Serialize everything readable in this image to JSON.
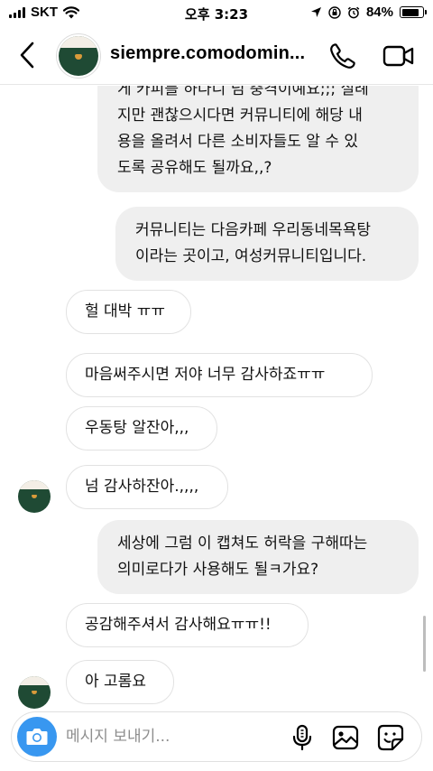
{
  "status_bar": {
    "carrier": "SKT",
    "time": "오후 3:23",
    "battery": "84%",
    "battery_level": 0.84
  },
  "header": {
    "username": "siempre.comodomin...",
    "icons": [
      "back-chevron-icon",
      "phone-icon",
      "video-camera-icon"
    ]
  },
  "messages": [
    {
      "side": "out",
      "text": "게 카피를 하다니 넘 충격이예요;;; 실례\n지만 괜찮으시다면 커뮤니티에 해당 내\n용을 올려서 다른 소비자들도 알 수 있\n도록 공유해도 될까요,,?"
    },
    {
      "side": "out",
      "text": "커뮤니티는 다음카페 우리동네목욕탕\n이라는 곳이고, 여성커뮤니티입니다."
    },
    {
      "side": "in",
      "text": "헐 대박 ㅠㅠ"
    },
    {
      "side": "in",
      "text": "마음써주시면 저야 너무 감사하죠ㅠㅠ"
    },
    {
      "side": "in",
      "text": "우동탕 알잔아,,,"
    },
    {
      "side": "in",
      "text": "넘 감사하잔아.,,,,"
    },
    {
      "side": "out",
      "text": "세상에 그럼 이 캡쳐도 허락을 구해따는\n의미로다가 사용해도 될ㅋ가요?"
    },
    {
      "side": "in",
      "text": "공감해주셔서 감사해요ㅠㅠ!!"
    },
    {
      "side": "in",
      "text": "아 고롬요"
    }
  ],
  "composer": {
    "placeholder": "메시지 보내기...",
    "icons": [
      "camera-icon",
      "microphone-icon",
      "gallery-icon",
      "sticker-icon"
    ]
  },
  "colors": {
    "accent": "#3897f0",
    "outgoing_bubble": "#efefef",
    "incoming_border": "#e2e2e2",
    "avatar_green": "#1f4a34"
  }
}
